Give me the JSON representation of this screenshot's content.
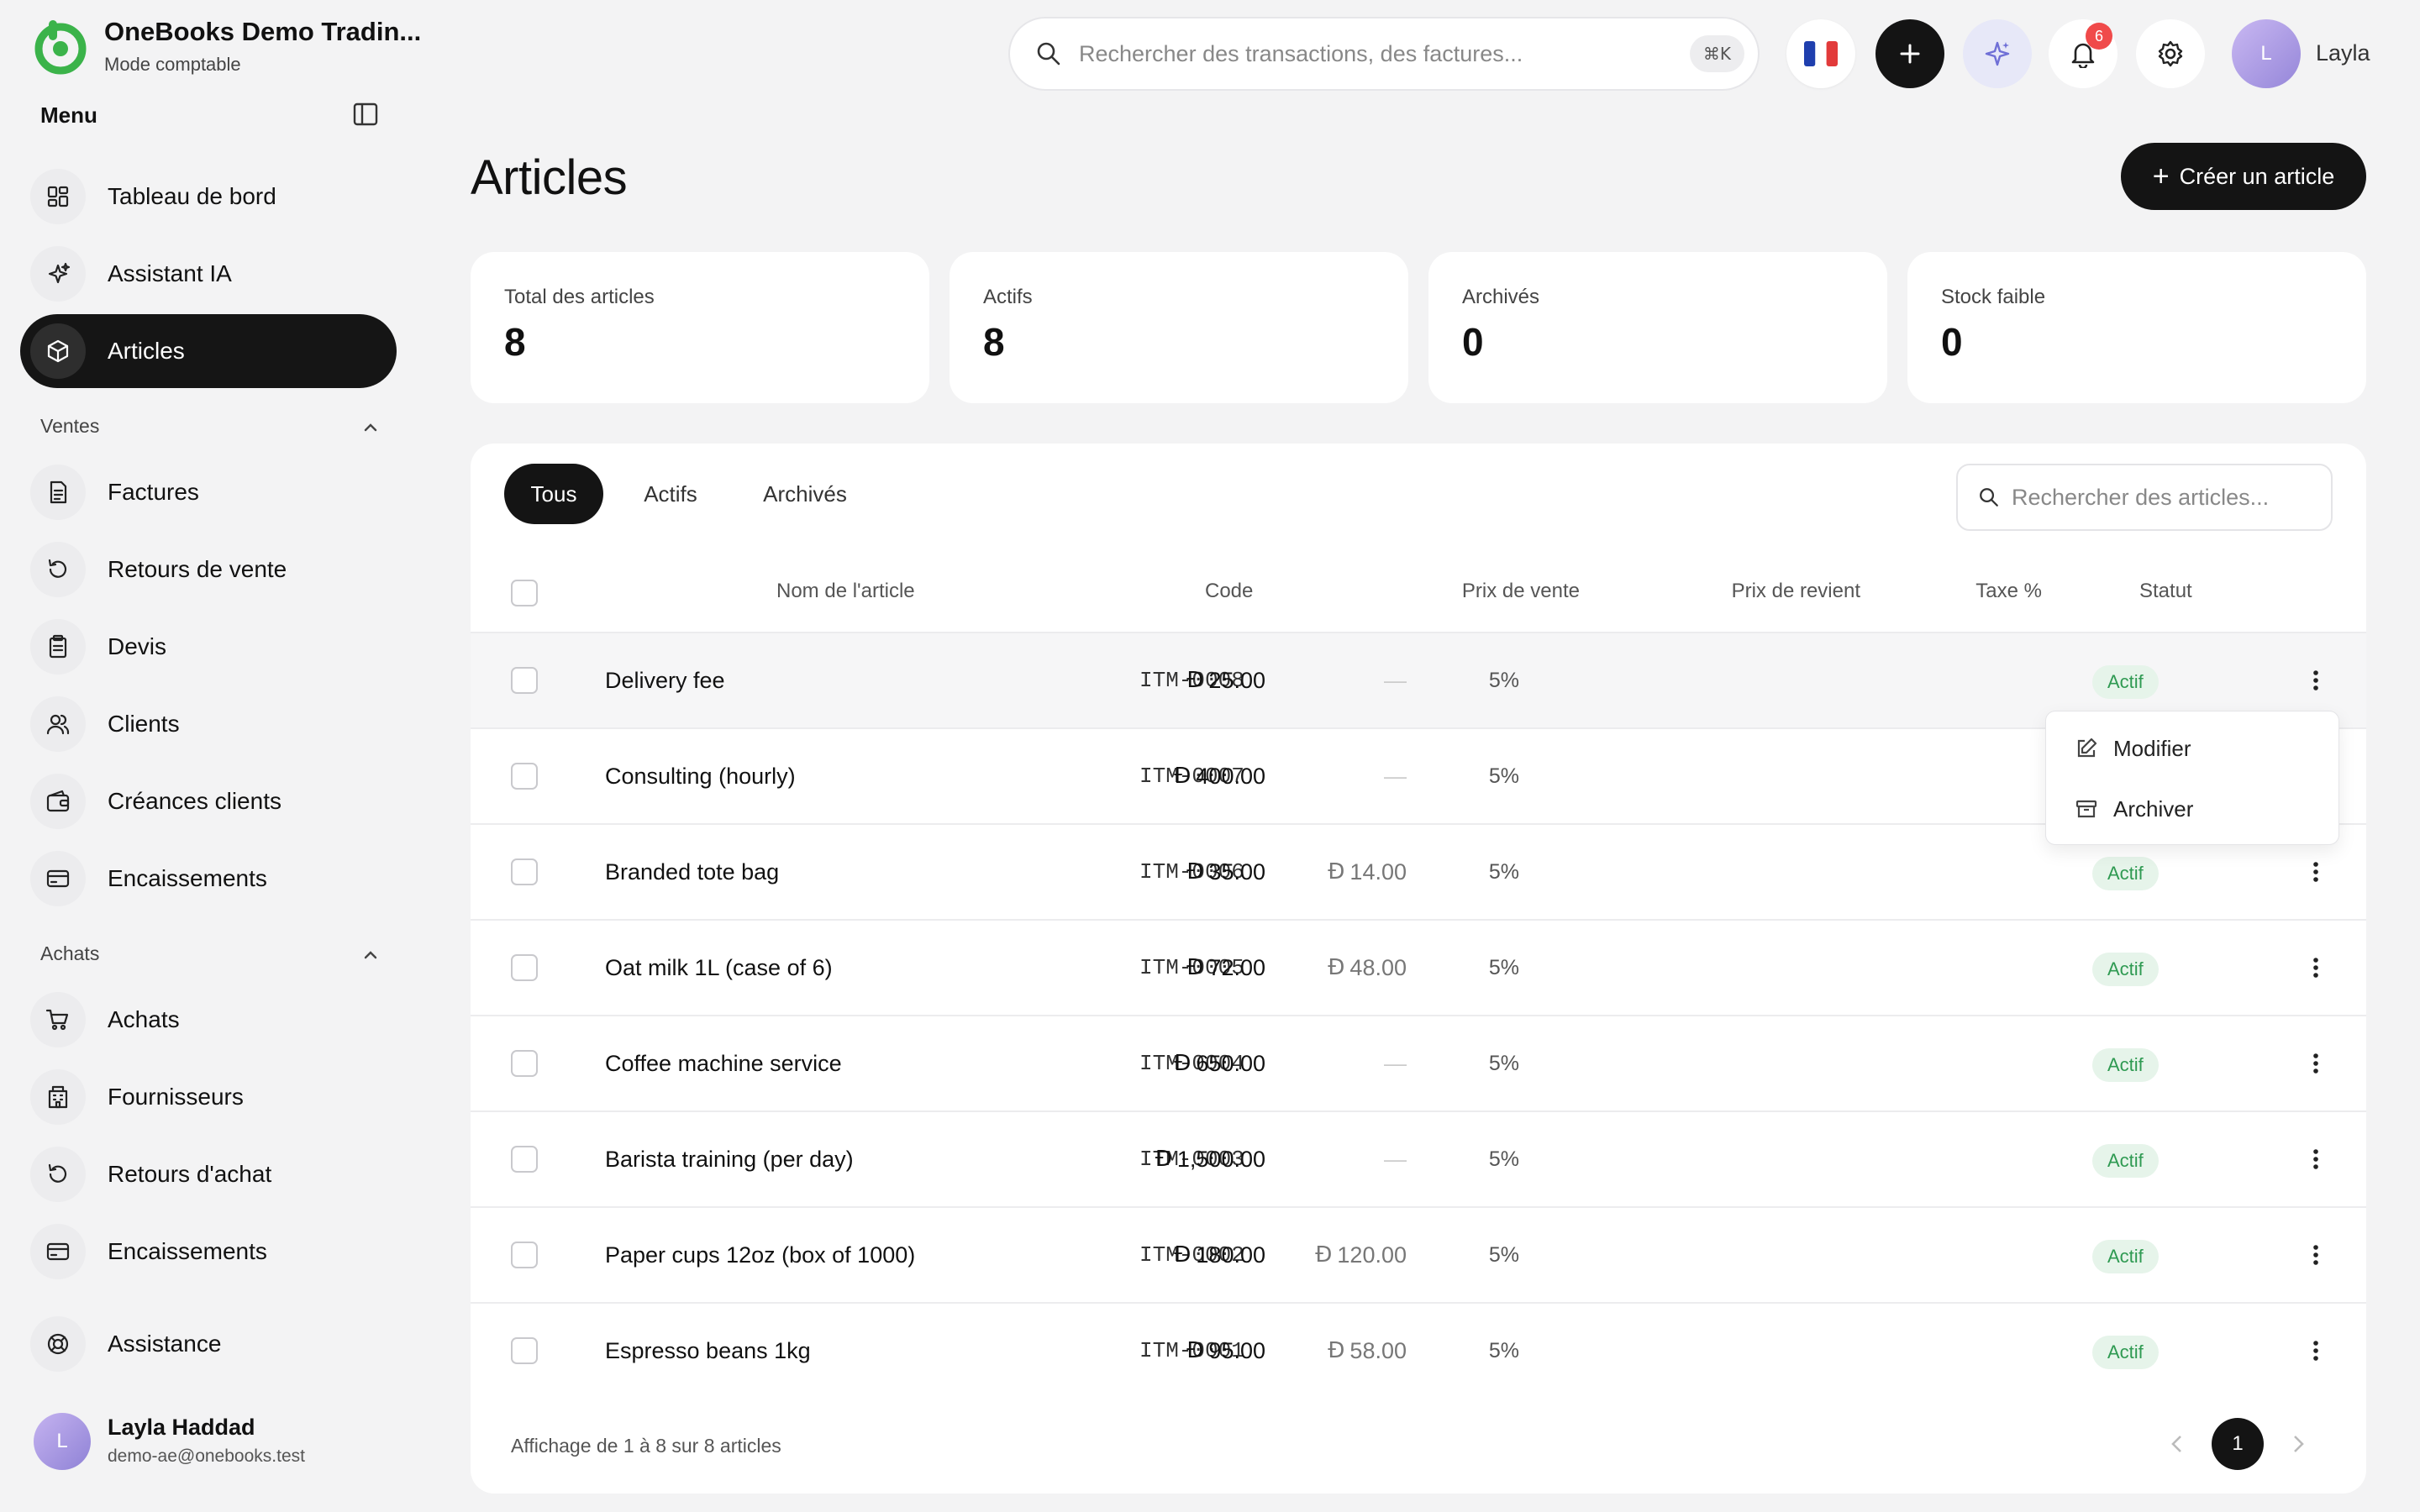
{
  "brand": {
    "name": "OneBooks Demo Tradin...",
    "mode": "Mode comptable"
  },
  "sidebar": {
    "menu_label": "Menu",
    "top_items": [
      {
        "label": "Tableau de bord",
        "icon": "dashboard-icon"
      },
      {
        "label": "Assistant IA",
        "icon": "sparkle-icon"
      },
      {
        "label": "Articles",
        "icon": "box-icon",
        "active": true
      }
    ],
    "sections": [
      {
        "title": "Ventes",
        "items": [
          {
            "label": "Factures",
            "icon": "invoice-icon"
          },
          {
            "label": "Retours de vente",
            "icon": "return-icon"
          },
          {
            "label": "Devis",
            "icon": "quote-icon"
          },
          {
            "label": "Clients",
            "icon": "users-icon"
          },
          {
            "label": "Créances clients",
            "icon": "wallet-icon"
          },
          {
            "label": "Encaissements",
            "icon": "card-icon"
          }
        ]
      },
      {
        "title": "Achats",
        "items": [
          {
            "label": "Achats",
            "icon": "cart-icon"
          },
          {
            "label": "Fournisseurs",
            "icon": "building-icon"
          },
          {
            "label": "Retours d'achat",
            "icon": "return-icon"
          },
          {
            "label": "Encaissements",
            "icon": "card-icon"
          }
        ]
      }
    ],
    "support": {
      "label": "Assistance",
      "icon": "lifebuoy-icon"
    },
    "user": {
      "initial": "L",
      "name": "Layla Haddad",
      "email": "demo-ae@onebooks.test"
    }
  },
  "topbar": {
    "search_placeholder": "Rechercher des transactions, des factures...",
    "shortcut": "⌘K",
    "notifications_count": "6",
    "user_initial": "L",
    "user_name": "Layla"
  },
  "page": {
    "title": "Articles",
    "create_label": "Créer un article"
  },
  "stats": [
    {
      "label": "Total des articles",
      "value": "8"
    },
    {
      "label": "Actifs",
      "value": "8"
    },
    {
      "label": "Archivés",
      "value": "0"
    },
    {
      "label": "Stock faible",
      "value": "0"
    }
  ],
  "tabs": [
    "Tous",
    "Actifs",
    "Archivés"
  ],
  "table_search_placeholder": "Rechercher des articles...",
  "columns": [
    "Nom de l'article",
    "Code",
    "Prix de vente",
    "Prix de revient",
    "Taxe %",
    "Statut"
  ],
  "currency_symbol": "Đ",
  "rows": [
    {
      "name": "Delivery fee",
      "code": "ITM-0008",
      "price": "25.00",
      "cost": "—",
      "tax": "5%",
      "status": "Actif"
    },
    {
      "name": "Consulting (hourly)",
      "code": "ITM-0007",
      "price": "400.00",
      "cost": "—",
      "tax": "5%",
      "status": "Actif"
    },
    {
      "name": "Branded tote bag",
      "code": "ITM-0006",
      "price": "35.00",
      "cost": "14.00",
      "tax": "5%",
      "status": "Actif"
    },
    {
      "name": "Oat milk 1L (case of 6)",
      "code": "ITM-0005",
      "price": "72.00",
      "cost": "48.00",
      "tax": "5%",
      "status": "Actif"
    },
    {
      "name": "Coffee machine service",
      "code": "ITM-0004",
      "price": "650.00",
      "cost": "—",
      "tax": "5%",
      "status": "Actif"
    },
    {
      "name": "Barista training (per day)",
      "code": "ITM-0003",
      "price": "1,500.00",
      "cost": "—",
      "tax": "5%",
      "status": "Actif"
    },
    {
      "name": "Paper cups 12oz (box of 1000)",
      "code": "ITM-0002",
      "price": "180.00",
      "cost": "120.00",
      "tax": "5%",
      "status": "Actif"
    },
    {
      "name": "Espresso beans 1kg",
      "code": "ITM-0001",
      "price": "95.00",
      "cost": "58.00",
      "tax": "5%",
      "status": "Actif"
    }
  ],
  "row_menu": {
    "edit_label": "Modifier",
    "archive_label": "Archiver"
  },
  "footer": {
    "text": "Affichage de 1 à 8 sur 8 articles",
    "current_page": "1"
  },
  "colors": {
    "accent": "#141414",
    "brand": "#3bb34a",
    "status_bg": "#e6f4ea",
    "status_text": "#2f9a52",
    "badge": "#f04a4a"
  }
}
